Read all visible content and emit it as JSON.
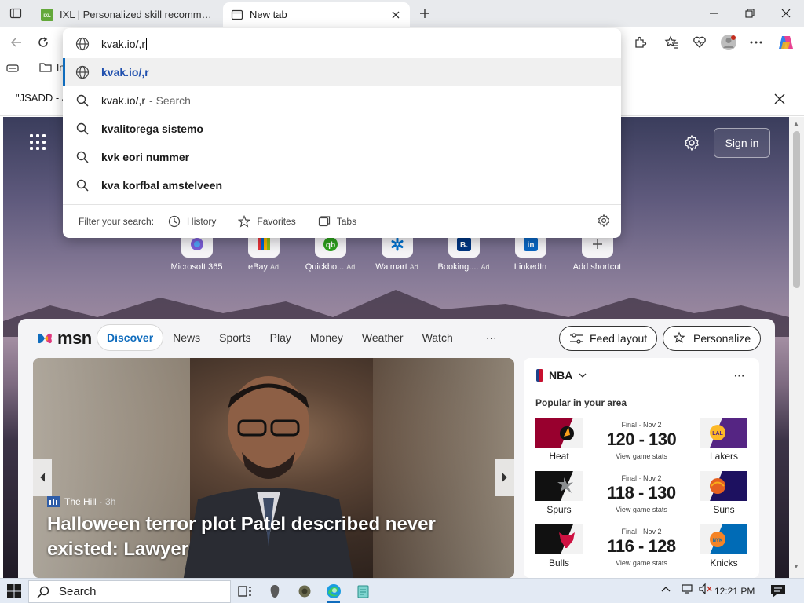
{
  "browser": {
    "tabs": [
      {
        "title": "IXL | Personalized skill recommendations",
        "favicon": "ixl-icon",
        "active": false
      },
      {
        "title": "New tab",
        "favicon": "newtab-icon",
        "active": true
      }
    ],
    "favorites_label": "In",
    "find_bar": {
      "query": "\"JSADD - J"
    }
  },
  "omnibox": {
    "typed": "kvak.io/,r",
    "suggestions": [
      {
        "icon": "globe-icon",
        "text": "kvak.io/,r",
        "suffix": ""
      },
      {
        "icon": "search-icon",
        "text": "kvak.io/,r",
        "suffix": "- Search"
      },
      {
        "icon": "search-icon",
        "prefix": "kvalito ",
        "text_light": "r",
        "text": "ega sistemo"
      },
      {
        "icon": "search-icon",
        "text": "kvk eori nummer"
      },
      {
        "icon": "search-icon",
        "text": "kva korfbal amstelveen"
      }
    ],
    "filter": {
      "label": "Filter your search:",
      "items": [
        "History",
        "Favorites",
        "Tabs"
      ]
    }
  },
  "page": {
    "signin": "Sign in",
    "shortcuts": [
      {
        "label": "Microsoft 365",
        "ad": ""
      },
      {
        "label": "eBay",
        "ad": "Ad"
      },
      {
        "label": "Quickbo...",
        "ad": "Ad"
      },
      {
        "label": "Walmart",
        "ad": "Ad"
      },
      {
        "label": "Booking....",
        "ad": "Ad"
      },
      {
        "label": "LinkedIn",
        "ad": ""
      },
      {
        "label": "Add shortcut",
        "ad": ""
      }
    ]
  },
  "feed": {
    "brand": "msn",
    "nav": [
      "Discover",
      "News",
      "Sports",
      "Play",
      "Money",
      "Weather",
      "Watch"
    ],
    "more": "···",
    "feed_layout": "Feed layout",
    "personalize": "Personalize",
    "hero": {
      "source": "The Hill",
      "age": "· 3h",
      "title": "Halloween terror plot Patel described never existed: Lawyer"
    },
    "sports": {
      "league": "NBA",
      "subtitle": "Popular in your area",
      "games": [
        {
          "status": "Final · Nov 2",
          "score": "120 - 130",
          "stats": "View game stats",
          "home": "Heat",
          "away": "Lakers",
          "home_color": "#98002e",
          "away_color": "#552583"
        },
        {
          "status": "Final · Nov 2",
          "score": "118 - 130",
          "stats": "View game stats",
          "home": "Spurs",
          "away": "Suns",
          "home_color": "#111111",
          "away_color": "#1d1160"
        },
        {
          "status": "Final · Nov 2",
          "score": "116 - 128",
          "stats": "View game stats",
          "home": "Bulls",
          "away": "Knicks",
          "home_color": "#111111",
          "away_color": "#006bb6"
        }
      ]
    }
  },
  "taskbar": {
    "search_placeholder": "Search",
    "time": "12:21 PM"
  }
}
